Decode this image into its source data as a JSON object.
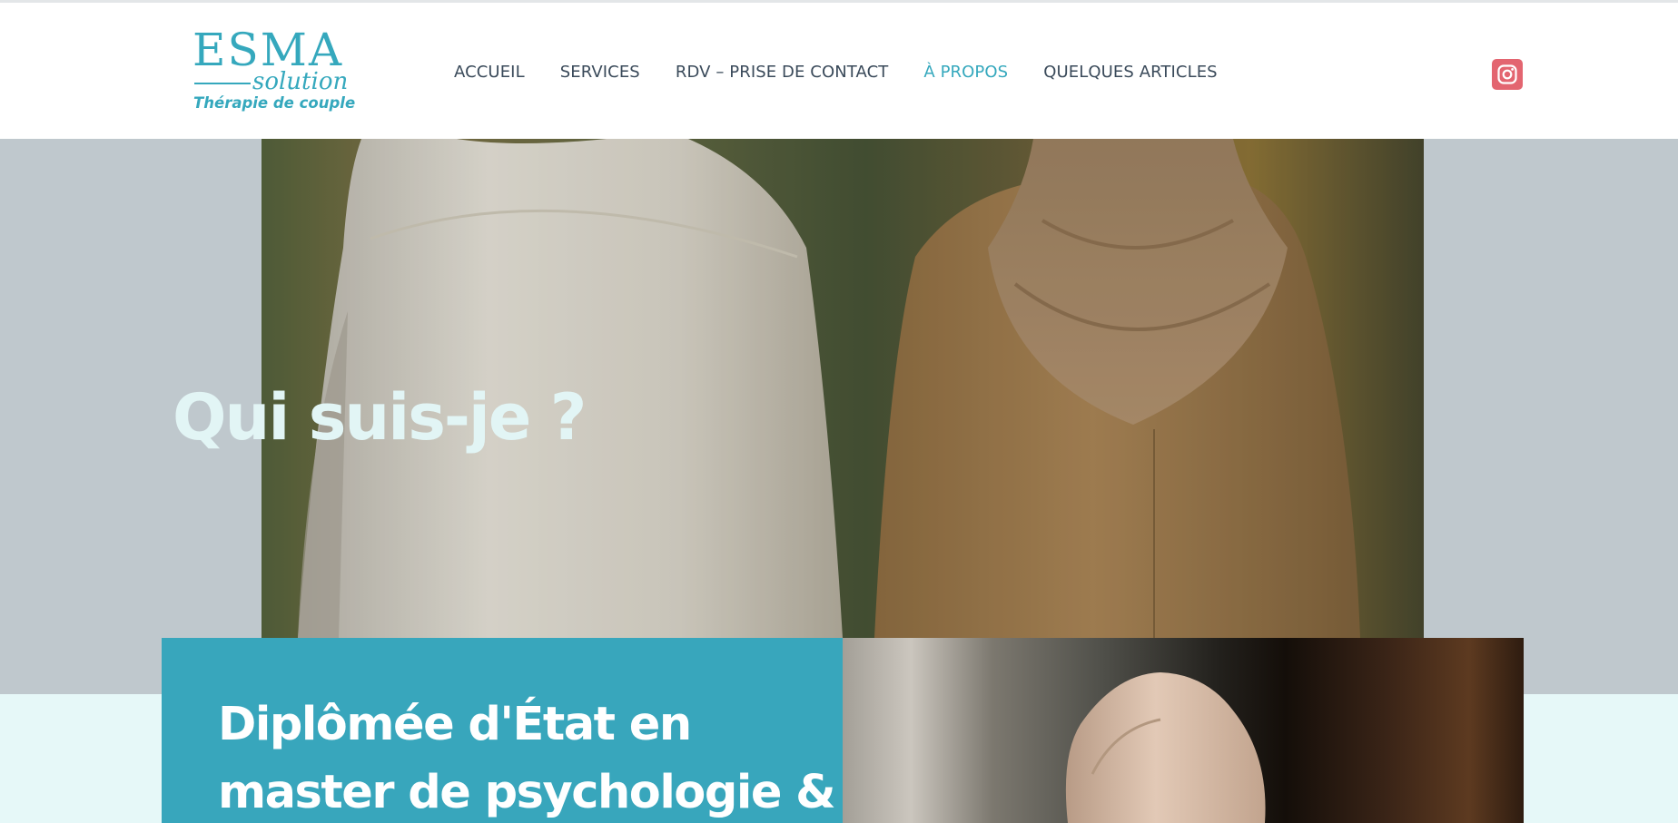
{
  "logo": {
    "brand": "ESMA",
    "script": "solution",
    "tagline": "Thérapie de couple"
  },
  "nav": {
    "items": [
      {
        "label": "ACCUEIL"
      },
      {
        "label": "SERVICES"
      },
      {
        "label": "RDV – PRISE DE CONTACT"
      },
      {
        "label": "À PROPOS"
      },
      {
        "label": "QUELQUES ARTICLES"
      }
    ],
    "active_index": 3
  },
  "social": {
    "icon": "instagram-icon"
  },
  "hero": {
    "title": "Qui suis-je ?",
    "image": "couple-walking-photo"
  },
  "intro": {
    "heading_line1": "Diplômée d'État en",
    "heading_line2": "master de psychologie &",
    "image": "woman-hijab-portrait-photo"
  },
  "colors": {
    "accent": "#35a8bd",
    "card": "#38a6bc",
    "instagram": "#e36570",
    "hero_band": "#bfc8cd",
    "lower_band": "#e6f8f8",
    "hero_title": "#e2f5f5",
    "nav_text": "#3a4a5a"
  }
}
